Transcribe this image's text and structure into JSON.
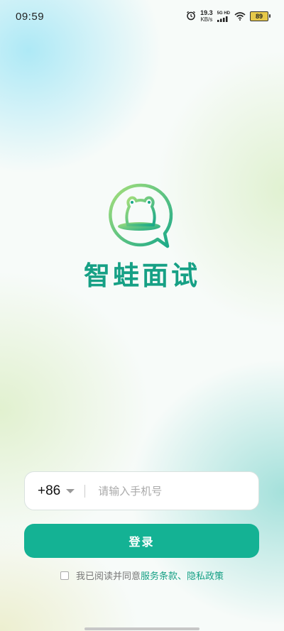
{
  "status_bar": {
    "time": "09:59",
    "speed_value": "19.3",
    "speed_unit": "KB/s",
    "network_label": "5G HD",
    "battery": "89",
    "icons": [
      "alarm-icon",
      "signal-icon",
      "wifi-icon",
      "battery-icon"
    ]
  },
  "app": {
    "name": "智蛙面试",
    "logo_icon": "frog-logo-icon",
    "brand_color": "#16a085",
    "accent_light": "#8edc7e"
  },
  "login": {
    "country_code": "+86",
    "phone_placeholder": "请输入手机号",
    "phone_value": "",
    "submit_label": "登录",
    "button_color": "#14b294"
  },
  "agreement": {
    "prefix": "我已阅读并同意",
    "terms_label": "服务条款",
    "separator": "、",
    "privacy_label": "隐私政策",
    "checked": false
  }
}
